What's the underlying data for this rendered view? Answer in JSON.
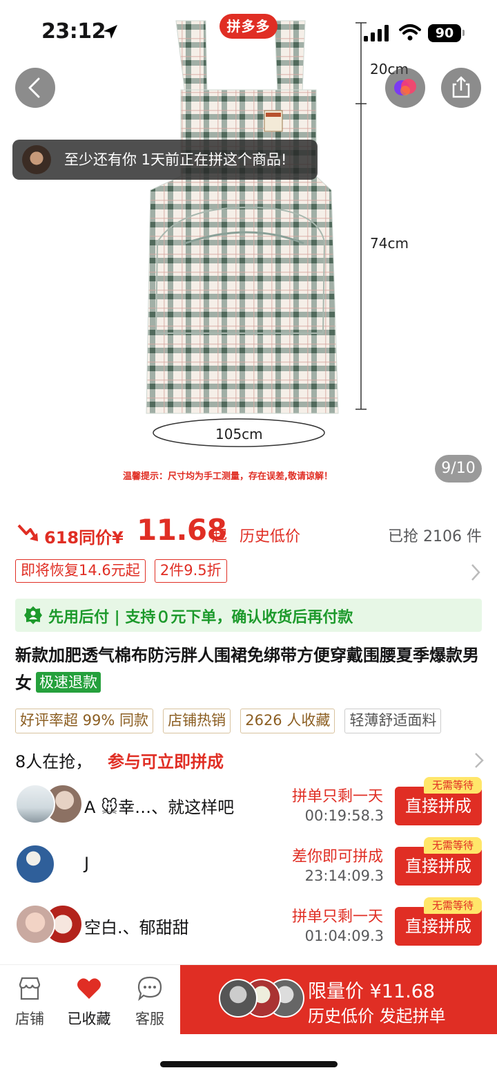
{
  "status_bar": {
    "time": "23:12",
    "battery": "90"
  },
  "app_logo": "拼多多",
  "gallery": {
    "counter": "9/10",
    "dim_top": "20cm",
    "dim_side": "74cm",
    "dim_bottom": "105cm",
    "tip_note": "温馨提示：尺寸均为手工测量，存在误差,敬请谅解！"
  },
  "notice": {
    "text": "至少还有你 1天前正在拼这个商品!"
  },
  "price": {
    "label": "618同价¥",
    "amount": "11.68",
    "suffix": "起",
    "history": "历史低价",
    "sold": "已抢 2106 件"
  },
  "coupons": [
    "即将恢复14.6元起",
    "2件9.5折"
  ],
  "pay_later": {
    "text": "先用后付 | 支持０元下单，确认收货后再付款"
  },
  "title": {
    "text": "新款加肥透气棉布防污胖人围裙免绑带方便穿戴围腰夏季爆款男女",
    "badge": "极速退款"
  },
  "tags": [
    "好评率超 99% 同款",
    "店铺热销",
    "2626 人收藏",
    "轻薄舒适面料"
  ],
  "grab": {
    "count": "8人在抢，",
    "cta": "参与可立即拼成"
  },
  "groups": [
    {
      "name": "A 🐭幸…、就这样吧",
      "status": "拼单只剩一天",
      "timer": "00:19:58.3",
      "button": "直接拼成",
      "badge": "无需等待"
    },
    {
      "name": "J",
      "status": "差你即可拼成",
      "timer": "23:14:09.3",
      "button": "直接拼成",
      "badge": "无需等待"
    },
    {
      "name": "空白.、郁甜甜",
      "status": "拼单只剩一天",
      "timer": "01:04:09.3",
      "button": "直接拼成",
      "badge": "无需等待"
    }
  ],
  "bottom_bar": {
    "store": "店铺",
    "favorite": "已收藏",
    "service": "客服",
    "buy_line1": "限量价 ¥11.68",
    "buy_line2": "历史低价 发起拼单"
  },
  "colors": {
    "brand_red": "#e02e24",
    "green": "#1d9a2c",
    "tag_gold": "#8c5f23"
  }
}
